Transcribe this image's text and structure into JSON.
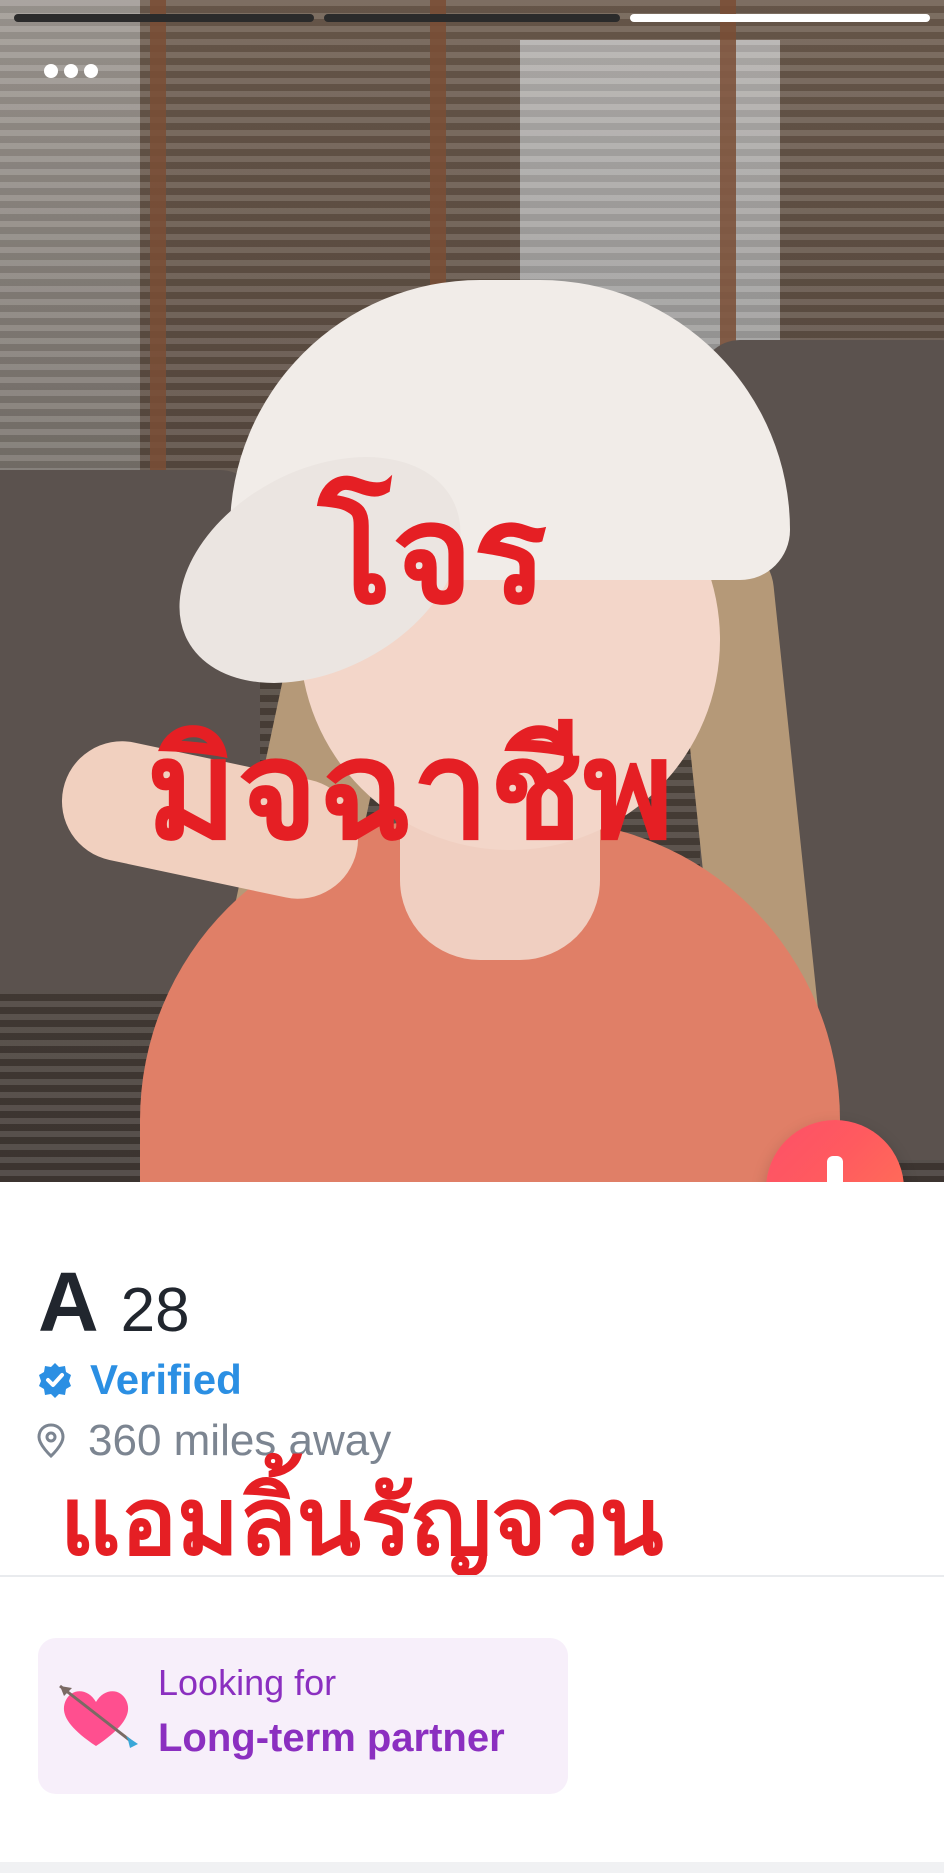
{
  "photo": {
    "progress_segments": [
      {
        "state": "inactive",
        "color": "#2b2b2b"
      },
      {
        "state": "inactive",
        "color": "#2b2b2b"
      },
      {
        "state": "active",
        "color": "#ffffff"
      }
    ],
    "menu_icon": "more-dots-icon",
    "overlay": {
      "line1": "โจร",
      "line2": "มิจฉาชีพ",
      "color": "#e51f24"
    },
    "expand_button_icon": "arrow-down-icon",
    "expand_button_colors": [
      "#fd5068",
      "#ff7854"
    ]
  },
  "profile": {
    "name": "A",
    "age": "28",
    "verified_label": "Verified",
    "verified_icon": "verified-badge-icon",
    "verified_color": "#2b8fe3",
    "distance_label": "360 miles away",
    "distance_icon": "location-pin-icon",
    "overlay_name": "แอมลิ้นรัญจวน",
    "looking_for": {
      "title": "Looking for",
      "value": "Long-term partner",
      "icon": "heart-arrow-icon",
      "accent": "#8b2fc0"
    }
  }
}
